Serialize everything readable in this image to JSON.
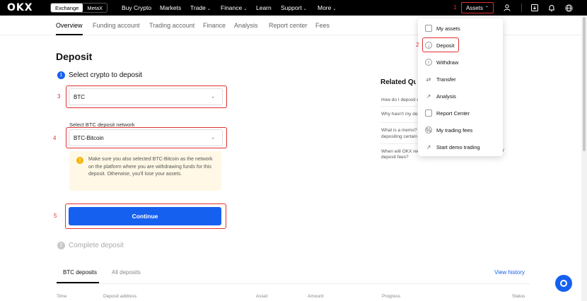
{
  "brand": {
    "logo_text": "OKX"
  },
  "mode_switch": {
    "exchange": "Exchange",
    "metax": "MetaX"
  },
  "nav": {
    "buy_crypto": "Buy Crypto",
    "markets": "Markets",
    "trade": "Trade",
    "finance": "Finance",
    "learn": "Learn",
    "support": "Support",
    "more": "More",
    "assets": "Assets"
  },
  "subnav": {
    "overview": "Overview",
    "funding": "Funding account",
    "trading": "Trading account",
    "finance": "Finance",
    "analysis": "Analysis",
    "report": "Report center",
    "fees": "Fees"
  },
  "page": {
    "title": "Deposit"
  },
  "step1": {
    "num": "1",
    "label": "Select crypto to deposit"
  },
  "crypto_select": {
    "value": "BTC"
  },
  "network": {
    "label": "Select BTC deposit network",
    "value": "BTC-Bitcoin"
  },
  "warning": {
    "icon": "!",
    "text": "Make sure you also selected BTC-Bitcoin as the network on the platform where you are withdrawing funds for this deposit. Otherwise, you'll lose your assets."
  },
  "continue_label": "Continue",
  "step2": {
    "num": "2",
    "label": "Complete deposit"
  },
  "history": {
    "tab_btc": "BTC deposits",
    "tab_all": "All deposits",
    "view_history": "View history",
    "columns": [
      "Time",
      "Deposit address",
      "Asset",
      "Amount",
      "Progress",
      "Status"
    ]
  },
  "related": {
    "title": "Related Qu",
    "items": [
      "How do I deposit c",
      "Why hasn't my depo",
      "What is a memo?",
      "depositing certain",
      "When will OKX rec"
    ],
    "tail1": "ay",
    "tail2": "deposit fees?"
  },
  "annotations": [
    "1",
    "2",
    "3",
    "4",
    "5"
  ],
  "dropdown": {
    "items": [
      {
        "label": "My assets",
        "icon": "wallet-icon"
      },
      {
        "label": "Deposit",
        "icon": "deposit-icon"
      },
      {
        "label": "Withdraw",
        "icon": "withdraw-icon"
      },
      {
        "label": "Transfer",
        "icon": "transfer-icon"
      },
      {
        "label": "Analysis",
        "icon": "analysis-icon"
      },
      {
        "label": "Report Center",
        "icon": "report-icon"
      },
      {
        "label": "My trading fees",
        "icon": "fees-icon"
      },
      {
        "label": "Start demo trading",
        "icon": "demo-icon"
      }
    ]
  },
  "colors": {
    "accent": "#1660f0",
    "annotation": "#e03131",
    "warning_bg": "#fff8e6"
  }
}
